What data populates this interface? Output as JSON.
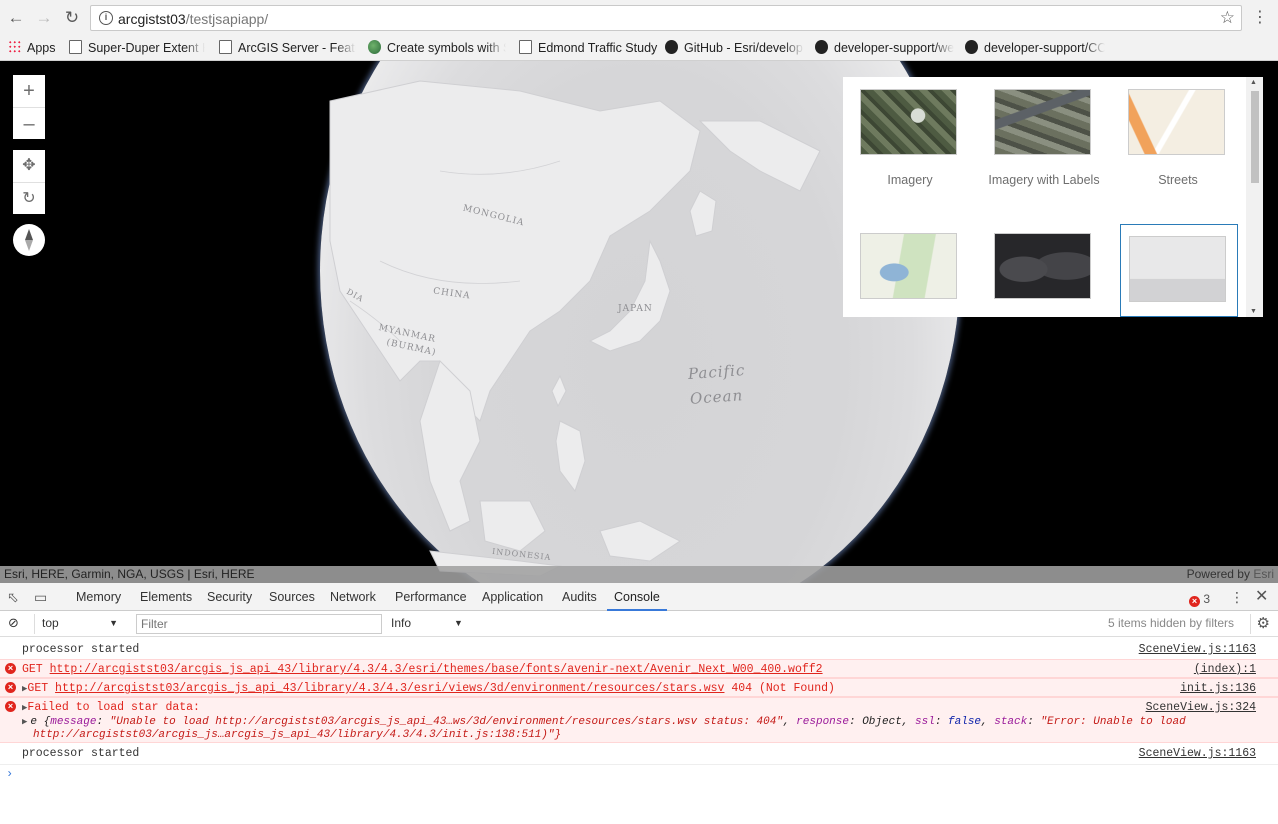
{
  "browser": {
    "url_host": "arcgistst03",
    "url_path": "/testjsapiapp/",
    "bookmarks": [
      {
        "label": "Apps",
        "icon": "apps-grid-icon"
      },
      {
        "label": "Super-Duper Extent H",
        "icon": "page-icon"
      },
      {
        "label": "ArcGIS Server - Featu",
        "icon": "page-icon"
      },
      {
        "label": "Create symbols with S",
        "icon": "globe-icon"
      },
      {
        "label": "Edmond Traffic Study",
        "icon": "page-icon"
      },
      {
        "label": "GitHub - Esri/develop",
        "icon": "github-icon"
      },
      {
        "label": "developer-support/we",
        "icon": "github-icon"
      },
      {
        "label": "developer-support/CC",
        "icon": "github-icon"
      }
    ]
  },
  "map": {
    "labels": {
      "mongolia": "MONGOLIA",
      "china": "CHINA",
      "myanmar1": "MYANMAR",
      "myanmar2": "(BURMA)",
      "japan": "JAPAN",
      "ocean1": "Pacific",
      "ocean2": "Ocean",
      "india": "DIA",
      "indonesia": "INDONESIA"
    },
    "attribution": "Esri, HERE, Garmin, NGA, USGS | Esri, HERE",
    "powered_by": "Powered by",
    "powered_brand": "Esri"
  },
  "basemap_gallery": {
    "items": [
      {
        "label": "Imagery"
      },
      {
        "label": "Imagery with Labels"
      },
      {
        "label": "Streets"
      },
      {
        "label": ""
      },
      {
        "label": ""
      },
      {
        "label": ""
      }
    ],
    "selected_index": 5
  },
  "devtools": {
    "tabs": [
      "Memory",
      "Elements",
      "Security",
      "Sources",
      "Network",
      "Performance",
      "Application",
      "Audits",
      "Console"
    ],
    "active_tab": "Console",
    "error_count": "3",
    "context": "top",
    "filter_placeholder": "Filter",
    "level": "Info",
    "hidden_note": "5 items hidden by filters",
    "logs": [
      {
        "text": "processor started",
        "source": "SceneView.js:1163"
      },
      {
        "method": "GET",
        "url": "http://arcgistst03/arcgis_js_api_43/library/4.3/4.3/esri/themes/base/fonts/avenir-next/Avenir_Next_W00_400.woff2",
        "source": "(index):1"
      },
      {
        "method": "GET",
        "url": "http://arcgistst03/arcgis_js_api_43/library/4.3/4.3/esri/views/3d/environment/resources/stars.wsv",
        "status": "404 (Not Found)",
        "source": "init.js:136"
      },
      {
        "text": "Failed to load star data:",
        "source": "SceneView.js:324",
        "detail_prefix": "e {",
        "message_key": "message",
        "message_val": "\"Unable to load http://arcgistst03/arcgis_js_api_43…ws/3d/environment/resources/stars.wsv status: 404\"",
        "response_key": "response",
        "response_val": "Object",
        "ssl_key": "ssl",
        "ssl_val": "false",
        "stack_key": "stack",
        "stack_val1": "\"Error: Unable to load",
        "stack_val2": "http://arcgistst03/arcgis_js…arcgis_js_api_43/library/4.3/4.3/init.js:138:511)\"}"
      },
      {
        "text": "processor started",
        "source": "SceneView.js:1163"
      }
    ]
  }
}
